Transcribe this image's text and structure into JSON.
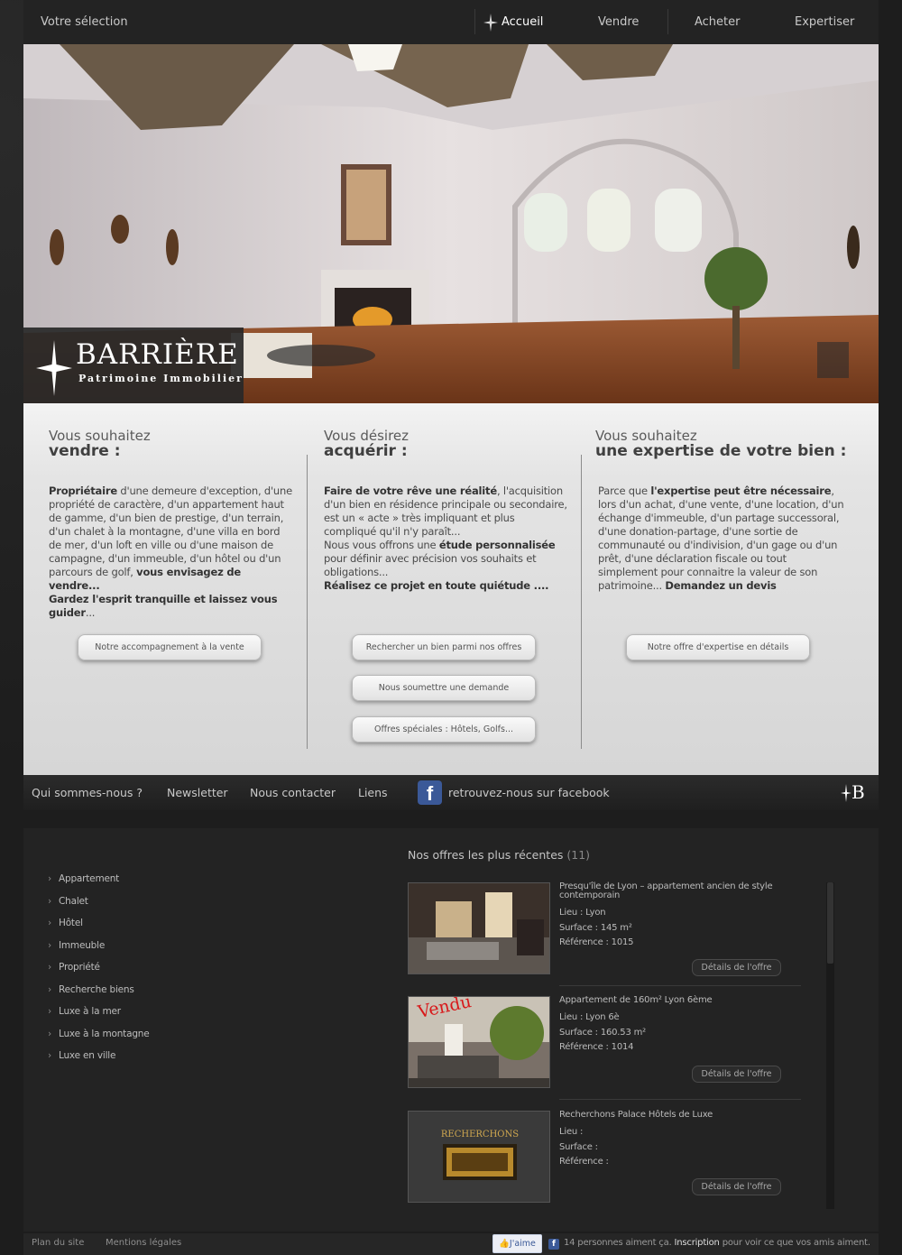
{
  "topnav": {
    "selection": "Votre sélection",
    "items": [
      "Accueil",
      "Vendre",
      "Acheter",
      "Expertiser"
    ]
  },
  "logo": {
    "brand": "BARRIÈRE",
    "subtitle": "Patrimoine Immobilier"
  },
  "columns": [
    {
      "title_light": "Vous souhaitez",
      "title_bold": "vendre :",
      "text_lead": "Propriétaire",
      "text_body": " d'une demeure d'exception, d'une propriété de caractère, d'un appartement haut de gamme, d'un bien de prestige, d'un terrain, d'un chalet à la montagne, d'une villa en bord de mer, d'un loft en ville ou d'une maison de campagne, d'un immeuble, d'un hôtel ou d'un parcours de golf, ",
      "text_bold2": "vous envisagez de vendre...",
      "text_bold3": "Gardez l'esprit tranquille et laissez vous guider",
      "text_end": "...",
      "buttons": [
        "Notre accompagnement à la vente"
      ]
    },
    {
      "title_light": "Vous désirez",
      "title_bold": "acquérir :",
      "text_lead": "Faire de votre rêve une réalité",
      "text_body": ", l'acquisition d'un bien en résidence principale ou secondaire, est un « acte » très impliquant et plus compliqué qu'il n'y paraît...",
      "text_body2": "Nous vous offrons une ",
      "text_bold2": "étude personnalisée",
      "text_body3": " pour définir avec précision vos souhaits et obligations...",
      "text_bold3": "Réalisez ce projet en toute quiétude ....",
      "buttons": [
        "Rechercher un bien parmi nos offres",
        "Nous soumettre une demande",
        "Offres spéciales : Hôtels, Golfs..."
      ]
    },
    {
      "title_light": "Vous souhaitez",
      "title_bold": "une expertise de votre bien :",
      "text_pre": "Parce que ",
      "text_lead": "l'expertise peut être nécessaire",
      "text_body": ", lors d'un achat, d'une vente, d'une location, d'un échange d'immeuble, d'un partage successoral, d'une donation-partage, d'une sortie de communauté ou d'indivision, d'un gage ou d'un prêt, d'une déclaration fiscale ou tout simplement pour connaitre la valeur de son patrimoine... ",
      "text_bold2": "Demandez un devis",
      "buttons": [
        "Notre offre d'expertise en détails"
      ]
    }
  ],
  "botnav": {
    "items": [
      "Qui sommes-nous ?",
      "Newsletter",
      "Nous contacter",
      "Liens"
    ],
    "facebook": "retrouvez-nous sur facebook",
    "mark": "B"
  },
  "categories": [
    "Appartement",
    "Chalet",
    "Hôtel",
    "Immeuble",
    "Propriété",
    "Recherche biens",
    "Luxe à la mer",
    "Luxe à la montagne",
    "Luxe en ville"
  ],
  "offers": {
    "title": "Nos offres les plus récentes",
    "count": "(11)",
    "details_label": "Détails de l'offre",
    "items": [
      {
        "title": "Presqu'île de Lyon – appartement ancien de style contemporain",
        "lieu": "Lieu : Lyon",
        "surface": "Surface : 145 m²",
        "reference": "Référence : 1015"
      },
      {
        "title": "Appartement de 160m² Lyon 6ème",
        "lieu": "Lieu : Lyon 6è",
        "surface": "Surface : 160.53 m²",
        "reference": "Référence : 1014",
        "badge": "Vendu"
      },
      {
        "title": "Recherchons Palace Hôtels de Luxe",
        "lieu": "Lieu :",
        "surface": "Surface :",
        "reference": "Référence :",
        "thumb_text": "RECHERCHONS"
      }
    ]
  },
  "footer": {
    "sitemap": "Plan du site",
    "legal": "Mentions légales",
    "like": "J'aime",
    "likes_text": "14 personnes aiment ça.",
    "signup": "Inscription",
    "likes_tail": "pour voir ce que vos amis aiment."
  },
  "colors": {
    "facebook": "#3b5998",
    "background": "#1d1d1d",
    "panel": "#e4e4e4"
  }
}
